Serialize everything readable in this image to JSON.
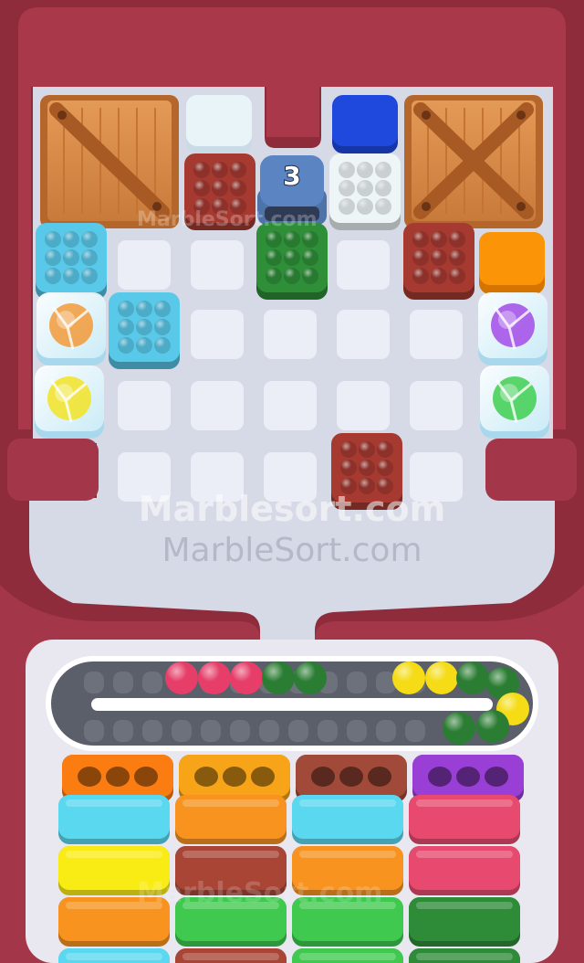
{
  "game": {
    "title": "Marble Sort",
    "watermark_primary": "Marblesort.com",
    "watermark_secondary": "MarbleSort.com",
    "watermark_faint": "MarbleSort.com"
  },
  "board": {
    "rows": 5,
    "cols": 7,
    "crates": [
      {
        "name": "wooden-crate-left"
      },
      {
        "name": "wooden-crate-right"
      }
    ],
    "counter_block": {
      "label": "3"
    },
    "blocks": [
      {
        "color": "#a63a31",
        "kind": "marble-block",
        "name": "block-red-top"
      },
      {
        "color": "#eef5f6",
        "kind": "marble-block",
        "name": "block-white-top"
      },
      {
        "color": "#2e8f38",
        "kind": "marble-block",
        "name": "block-green-top"
      },
      {
        "color": "#a63a31",
        "kind": "marble-block",
        "name": "block-red-right"
      },
      {
        "color": "#59c9ea",
        "kind": "marble-block",
        "name": "block-cyan-left"
      },
      {
        "color": "#59c9ea",
        "kind": "marble-block",
        "name": "block-cyan-mid"
      },
      {
        "color": "#a63a31",
        "kind": "marble-block",
        "name": "block-red-lower"
      },
      {
        "color": "#e9f4f9",
        "kind": "solid-block",
        "name": "block-white-solid"
      },
      {
        "color": "#1f48dc",
        "kind": "solid-block",
        "name": "block-blue-solid"
      },
      {
        "color": "#fb9407",
        "kind": "solid-block",
        "name": "block-orange-solid"
      },
      {
        "color": "#f29a3a",
        "kind": "ice-block",
        "name": "ice-block-orange"
      },
      {
        "color": "#f2e325",
        "kind": "ice-block",
        "name": "ice-block-yellow"
      },
      {
        "color": "#a24be8",
        "kind": "ice-block",
        "name": "ice-block-purple"
      },
      {
        "color": "#3fcf50",
        "kind": "ice-block",
        "name": "ice-block-green"
      }
    ]
  },
  "conveyor": {
    "marbles": [
      {
        "color": "#e63e68"
      },
      {
        "color": "#e63e68"
      },
      {
        "color": "#e63e68"
      },
      {
        "color": "#2b7d33"
      },
      {
        "color": "#2b7d33"
      },
      {
        "color": "#f5dc16"
      },
      {
        "color": "#f5dc16"
      },
      {
        "color": "#2b7d33"
      },
      {
        "color": "#2b7d33"
      },
      {
        "color": "#f5dc16"
      },
      {
        "color": "#2b7d33"
      },
      {
        "color": "#2b7d33"
      }
    ]
  },
  "sort_columns": [
    {
      "name": "sort-column-1",
      "tray": "#fb7d12",
      "trays": [
        "#fb7d12",
        "#5ad8ef",
        "#f9ec15",
        "#f7931e",
        "#5ad8ef"
      ]
    },
    {
      "name": "sort-column-2",
      "tray": "#f8a419",
      "trays": [
        "#f8a419",
        "#f7931e",
        "#a84535",
        "#3fc94e",
        "#a84535"
      ]
    },
    {
      "name": "sort-column-3",
      "tray": "#a24a3a",
      "trays": [
        "#a24a3a",
        "#5ad8ef",
        "#f7931e",
        "#3fc94e",
        "#3fc94e"
      ]
    },
    {
      "name": "sort-column-4",
      "tray": "#9a3fd6",
      "trays": [
        "#9a3fd6",
        "#e74a6e",
        "#e74a6e",
        "#2e8b38",
        "#2e8b38"
      ]
    }
  ],
  "colors": {
    "frame": "#8f2c3c",
    "frame_light": "#b4404f",
    "board_bg": "#d6dae6",
    "cell": "#ebeef6",
    "conveyor_bg": "#f1f1f5"
  }
}
